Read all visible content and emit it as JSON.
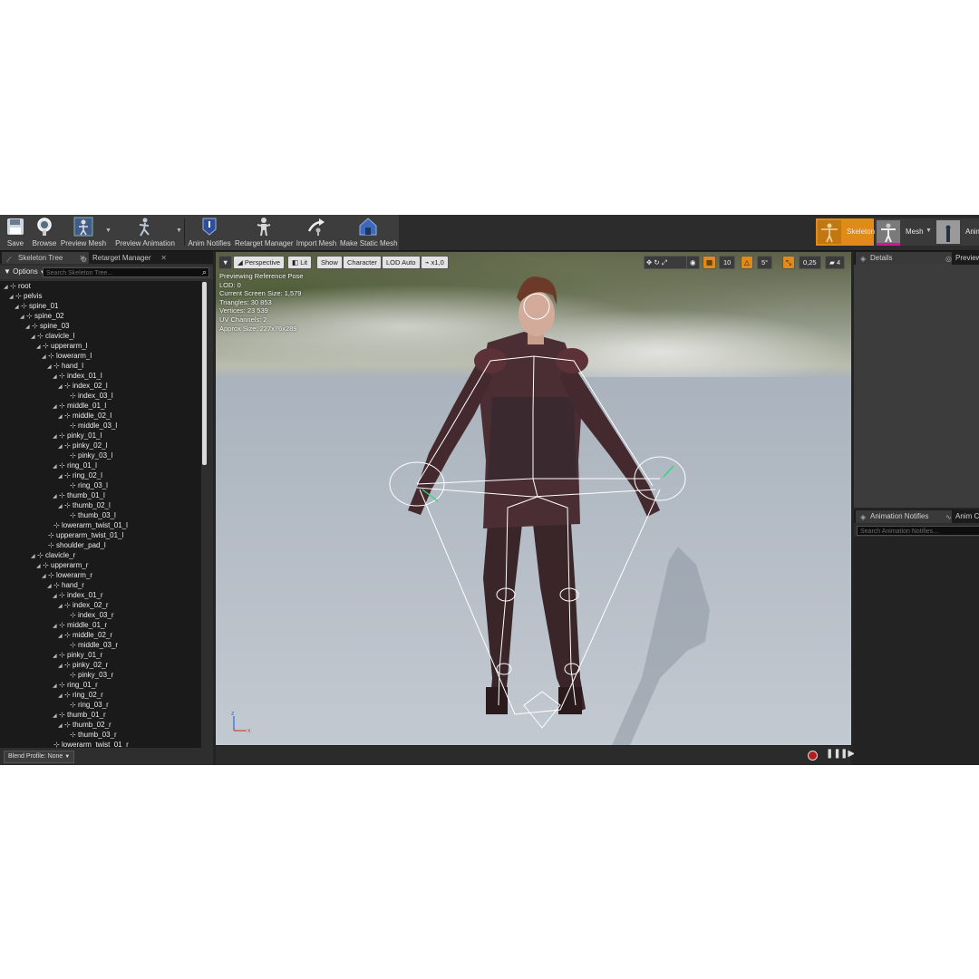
{
  "toolbar": {
    "buttons": [
      {
        "label": "Save",
        "icon": "save-icon"
      },
      {
        "label": "Browse",
        "icon": "browse-icon"
      },
      {
        "label": "Preview Mesh",
        "icon": "preview-mesh-icon"
      },
      {
        "label": "Preview Animation",
        "icon": "preview-animation-icon"
      },
      {
        "label": "Anim Notifies",
        "icon": "anim-notifies-icon"
      },
      {
        "label": "Retarget Manager",
        "icon": "retarget-manager-icon"
      },
      {
        "label": "Import Mesh",
        "icon": "import-mesh-icon"
      },
      {
        "label": "Make Static Mesh",
        "icon": "make-static-mesh-icon"
      }
    ],
    "modes": [
      {
        "label": "Skeleton",
        "active": true
      },
      {
        "label": "Mesh",
        "active": false
      },
      {
        "label": "Anim",
        "active": false
      }
    ]
  },
  "left_panel": {
    "tabs": [
      "Skeleton Tree",
      "Retarget Manager"
    ],
    "options_label": "Options",
    "search_placeholder": "Search Skeleton Tree...",
    "blend_profile": "Blend Profile: None",
    "bones": [
      {
        "name": "root",
        "depth": 0
      },
      {
        "name": "pelvis",
        "depth": 1
      },
      {
        "name": "spine_01",
        "depth": 2
      },
      {
        "name": "spine_02",
        "depth": 3
      },
      {
        "name": "spine_03",
        "depth": 4
      },
      {
        "name": "clavicle_l",
        "depth": 5
      },
      {
        "name": "upperarm_l",
        "depth": 6
      },
      {
        "name": "lowerarm_l",
        "depth": 7
      },
      {
        "name": "hand_l",
        "depth": 8
      },
      {
        "name": "index_01_l",
        "depth": 9
      },
      {
        "name": "index_02_l",
        "depth": 10
      },
      {
        "name": "index_03_l",
        "depth": 11
      },
      {
        "name": "middle_01_l",
        "depth": 9
      },
      {
        "name": "middle_02_l",
        "depth": 10
      },
      {
        "name": "middle_03_l",
        "depth": 11
      },
      {
        "name": "pinky_01_l",
        "depth": 9
      },
      {
        "name": "pinky_02_l",
        "depth": 10
      },
      {
        "name": "pinky_03_l",
        "depth": 11
      },
      {
        "name": "ring_01_l",
        "depth": 9
      },
      {
        "name": "ring_02_l",
        "depth": 10
      },
      {
        "name": "ring_03_l",
        "depth": 11
      },
      {
        "name": "thumb_01_l",
        "depth": 9
      },
      {
        "name": "thumb_02_l",
        "depth": 10
      },
      {
        "name": "thumb_03_l",
        "depth": 11
      },
      {
        "name": "lowerarm_twist_01_l",
        "depth": 8
      },
      {
        "name": "upperarm_twist_01_l",
        "depth": 7
      },
      {
        "name": "shoulder_pad_l",
        "depth": 7
      },
      {
        "name": "clavicle_r",
        "depth": 5
      },
      {
        "name": "upperarm_r",
        "depth": 6
      },
      {
        "name": "lowerarm_r",
        "depth": 7
      },
      {
        "name": "hand_r",
        "depth": 8
      },
      {
        "name": "index_01_r",
        "depth": 9
      },
      {
        "name": "index_02_r",
        "depth": 10
      },
      {
        "name": "index_03_r",
        "depth": 11
      },
      {
        "name": "middle_01_r",
        "depth": 9
      },
      {
        "name": "middle_02_r",
        "depth": 10
      },
      {
        "name": "middle_03_r",
        "depth": 11
      },
      {
        "name": "pinky_01_r",
        "depth": 9
      },
      {
        "name": "pinky_02_r",
        "depth": 10
      },
      {
        "name": "pinky_03_r",
        "depth": 11
      },
      {
        "name": "ring_01_r",
        "depth": 9
      },
      {
        "name": "ring_02_r",
        "depth": 10
      },
      {
        "name": "ring_03_r",
        "depth": 11
      },
      {
        "name": "thumb_01_r",
        "depth": 9
      },
      {
        "name": "thumb_02_r",
        "depth": 10
      },
      {
        "name": "thumb_03_r",
        "depth": 11
      },
      {
        "name": "lowerarm_twist_01_r",
        "depth": 8
      }
    ]
  },
  "viewport": {
    "buttons": {
      "perspective": "Perspective",
      "lit": "Lit",
      "show": "Show",
      "character": "Character",
      "lod": "LOD Auto",
      "speed": "x1,0",
      "grid_size": "10",
      "rotation_snap": "5°",
      "scale_snap": "0,25",
      "camera_speed": "4"
    },
    "stats": [
      "Previewing Reference Pose",
      "LOD: 0",
      "Current Screen Size: 1,579",
      "Triangles: 30 853",
      "Vertices: 23 539",
      "UV Channels: 2",
      "Approx Size: 227x76x289"
    ],
    "axis": {
      "z": "z",
      "x": "x"
    }
  },
  "right_panel": {
    "top_tabs": [
      "Details",
      "Preview"
    ],
    "bottom_tabs": [
      "Animation Notifies",
      "Anim Cu"
    ],
    "notifies_search_placeholder": "Search Animation Notifies..."
  },
  "colors": {
    "accent": "#e08a19",
    "panel": "#2e2e2e",
    "tree_bg": "#1a1a1a",
    "bone_lines": "#ffffff"
  }
}
